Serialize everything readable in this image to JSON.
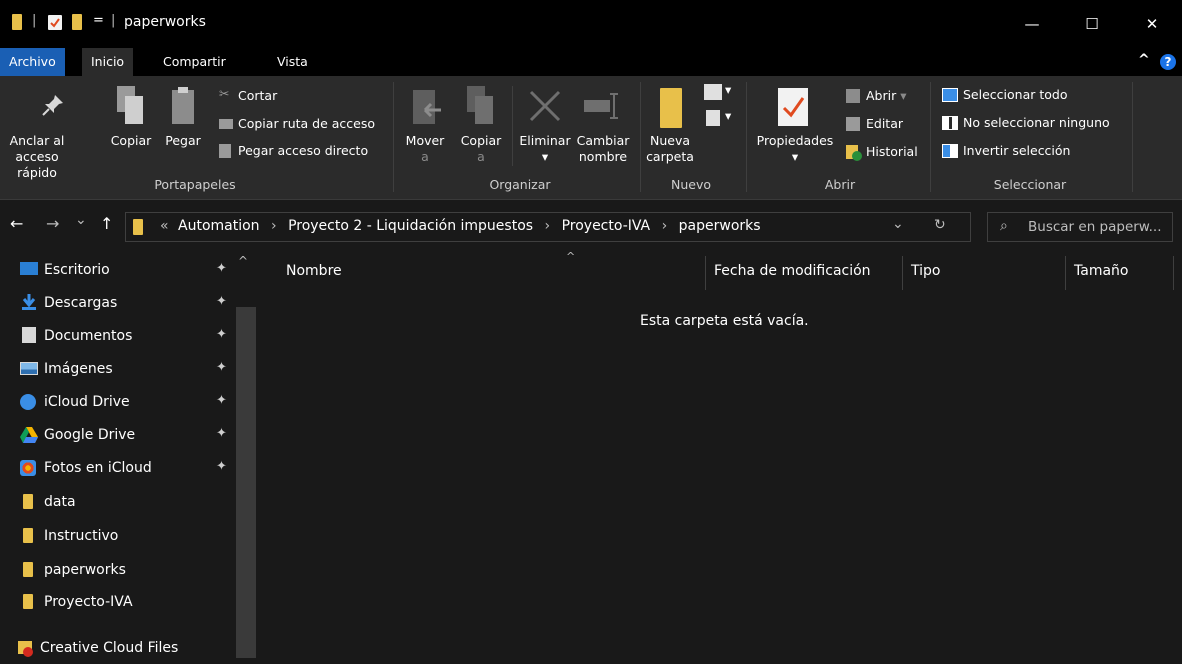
{
  "window": {
    "title": "paperworks",
    "qat_separator": "|",
    "qat_dropdown": "=",
    "minimize": "—",
    "maximize": "☐",
    "close": "✕"
  },
  "tabs": [
    {
      "label": "Archivo"
    },
    {
      "label": "Inicio"
    },
    {
      "label": "Compartir"
    },
    {
      "label": "Vista"
    }
  ],
  "ribbon": {
    "collapse_glyph": "^",
    "help_glyph": "?",
    "portapapeles": {
      "label": "Portapapeles",
      "anclar": [
        "Anclar al",
        "acceso rápido"
      ],
      "copiar": "Copiar",
      "pegar": "Pegar",
      "cortar": "Cortar",
      "copiar_ruta": "Copiar ruta de acceso",
      "pegar_acceso": "Pegar acceso directo"
    },
    "organizar": {
      "label": "Organizar",
      "mover": [
        "Mover",
        "a"
      ],
      "copiar": [
        "Copiar",
        "a"
      ],
      "eliminar": "Eliminar",
      "cambiar": [
        "Cambiar",
        "nombre"
      ]
    },
    "nuevo": {
      "label": "Nuevo",
      "nueva_carpeta": [
        "Nueva",
        "carpeta"
      ]
    },
    "abrir": {
      "label": "Abrir",
      "propiedades": "Propiedades",
      "abrir": "Abrir",
      "editar": "Editar",
      "historial": "Historial"
    },
    "seleccionar": {
      "label": "Seleccionar",
      "todo": "Seleccionar todo",
      "ninguno": "No seleccionar ninguno",
      "invertir": "Invertir selección"
    }
  },
  "address": {
    "back": "←",
    "forward": "→",
    "recent": "⌄",
    "up": "↑",
    "overflow": "«",
    "crumbs": [
      "Automation",
      "Proyecto 2 - Liquidación impuestos",
      "Proyecto-IVA",
      "paperworks"
    ],
    "separator": "›",
    "dropdown": "⌄",
    "refresh": "↻",
    "search_placeholder": "Buscar en paperw..."
  },
  "sidebar": {
    "scroll_up": "^",
    "pin_glyph": "📌",
    "items": [
      {
        "label": "Escritorio",
        "pinned": true
      },
      {
        "label": "Descargas",
        "pinned": true
      },
      {
        "label": "Documentos",
        "pinned": true
      },
      {
        "label": "Imágenes",
        "pinned": true
      },
      {
        "label": "iCloud Drive",
        "pinned": true
      },
      {
        "label": "Google Drive",
        "pinned": true
      },
      {
        "label": "Fotos en iCloud",
        "pinned": true
      },
      {
        "label": "data",
        "pinned": false
      },
      {
        "label": "Instructivo",
        "pinned": false
      },
      {
        "label": "paperworks",
        "pinned": false
      },
      {
        "label": "Proyecto-IVA",
        "pinned": false
      },
      {
        "label": "Creative Cloud Files",
        "pinned": false
      }
    ]
  },
  "content": {
    "columns": [
      "Nombre",
      "Fecha de modificación",
      "Tipo",
      "Tamaño"
    ],
    "sort_glyph": "^",
    "empty_message": "Esta carpeta está vacía."
  },
  "colors": {
    "accent": "#1a5fb4",
    "folder": "#e8c04a",
    "background": "#191919",
    "ribbon": "#2b2b2b"
  }
}
